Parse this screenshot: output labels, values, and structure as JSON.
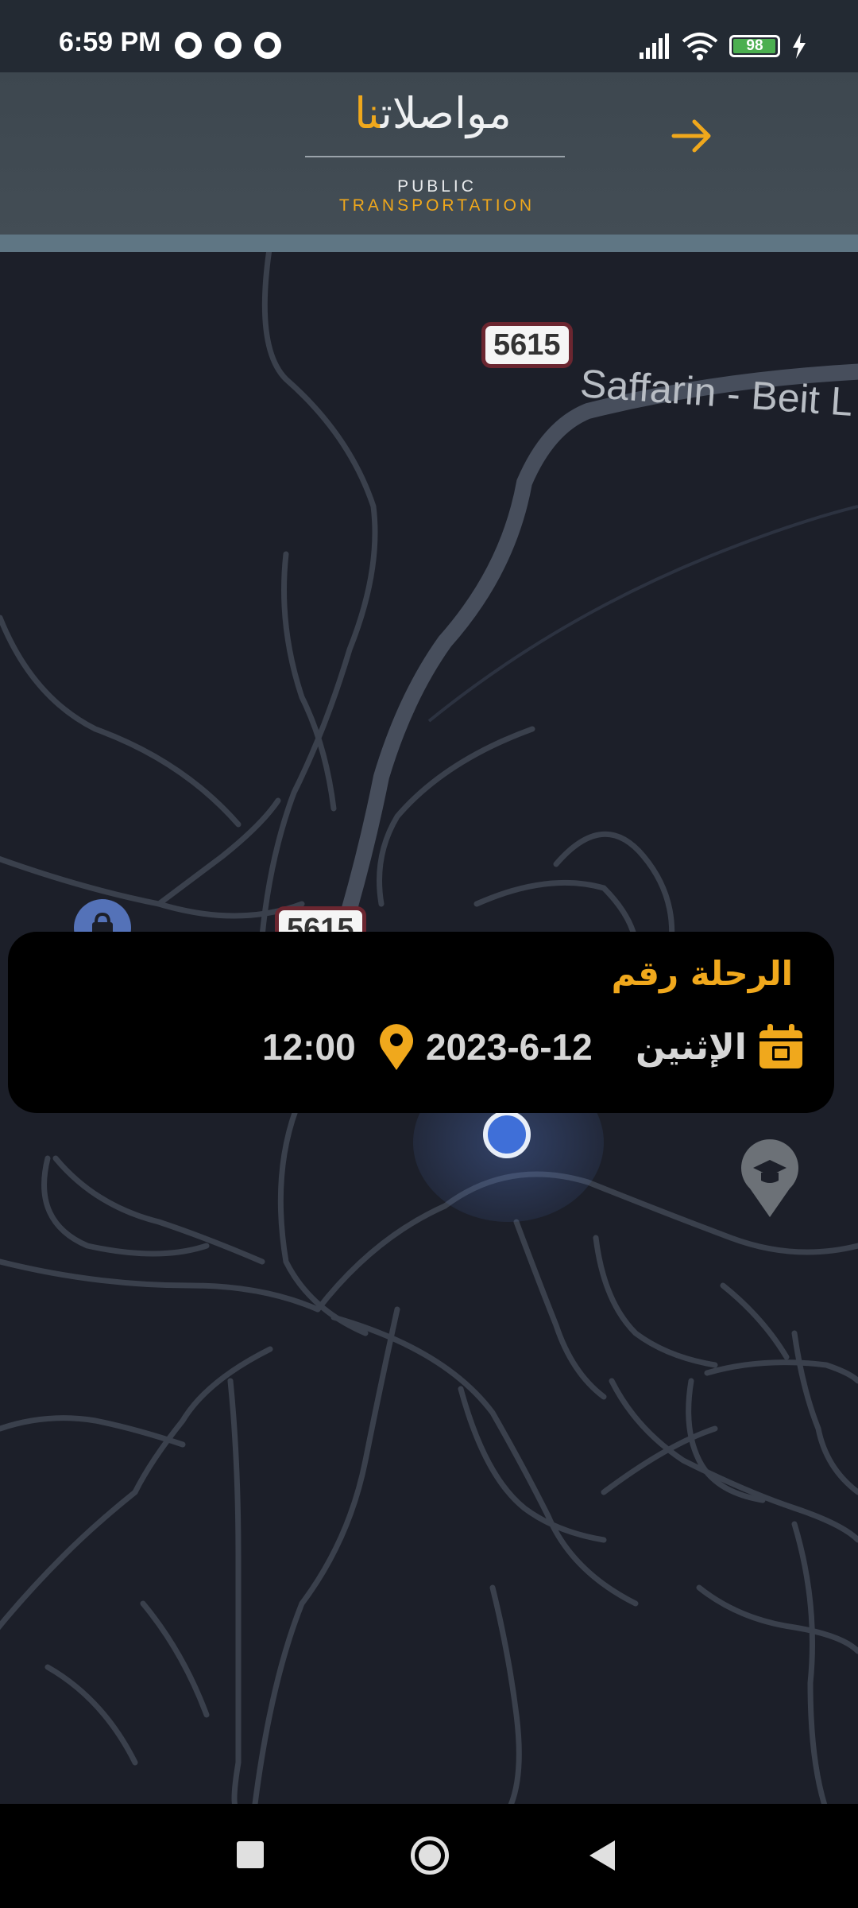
{
  "status_bar": {
    "time": "6:59 PM",
    "battery_level": "98",
    "battery_fraction": 0.98,
    "notification_icons": [
      "messenger-icon",
      "app-notification-icon",
      "app-notification-icon"
    ]
  },
  "header": {
    "logo_ar_main": "مواصلات",
    "logo_ar_accent": "نا",
    "logo_en_main": "PUBLIC ",
    "logo_en_accent": "TRANSPORTATION",
    "forward_icon": "arrow-right-icon"
  },
  "map": {
    "route_badge_top": "5615",
    "route_badge_lower": "5615",
    "place_label": "Saffarin - Beit L"
  },
  "trip_card": {
    "title": "الرحلة رقم",
    "day": "الإثنين",
    "date": "2023-6-12",
    "time": "12:00"
  },
  "colors": {
    "accent": "#f0a81c",
    "header_bg": "#414b53",
    "map_bg": "#1c1f29",
    "card_bg": "#000000"
  }
}
